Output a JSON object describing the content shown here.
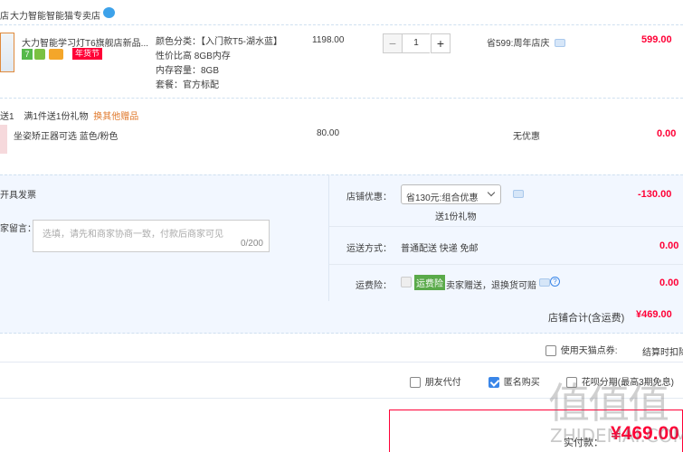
{
  "shop": {
    "prefix": "店",
    "name": "大力智能智能猫专卖店"
  },
  "product": {
    "title": "大力智能学习灯T6旗舰店新品...",
    "badge_year": "年货节",
    "attrs": [
      "颜色分类：【入门款T5-湖水蓝】",
      "性价比高 8GB内存",
      "内存容量：8GB",
      "套餐：官方标配"
    ],
    "price": "1198.00",
    "quantity": "1",
    "promo": "省599:周年店庆",
    "subtotal": "599.00"
  },
  "gift": {
    "prefix": "送1",
    "desc": "满1件送1份礼物",
    "link": "换其他赠品",
    "name": "坐姿矫正器可选 蓝色/粉色",
    "price": "80.00",
    "promo": "无优惠",
    "subtotal": "0.00"
  },
  "summary": {
    "ship_label": "开具发票",
    "note_label": "家留言：",
    "note_placeholder": "选填，请先和商家协商一致，付款后商家可见",
    "note_count": "0/200",
    "shop_discount_label": "店铺优惠：",
    "shop_discount_value": "省130元:组合优惠",
    "shop_discount_sub": "送1份礼物",
    "shop_discount_amount": "-130.00",
    "delivery_label": "运送方式：",
    "delivery_value": "普通配送 快递 免邮",
    "delivery_amount": "0.00",
    "insurance_label": "运费险：",
    "insurance_tag": "运费险",
    "insurance_desc": "卖家赠送，退换货可赔",
    "insurance_amount": "0.00",
    "total_label": "店铺合计(含运费)",
    "total_value": "¥469.00"
  },
  "options": {
    "tmall_points": "使用天猫点券:",
    "settle_note": "结算时扣除",
    "friend_pay": "朋友代付",
    "anonymous": "匿名购买",
    "installment": "花呗分期(最高3期免息)"
  },
  "checkout": {
    "label": "实付款：",
    "amount": "¥469.00"
  },
  "watermark": {
    "logo": "值值值",
    "site": "ZHIDEMAI.COM"
  },
  "colors": {
    "price_red": "#ff0036",
    "accent_blue": "#3a86e8",
    "panel_bg": "#f2f7ff"
  }
}
